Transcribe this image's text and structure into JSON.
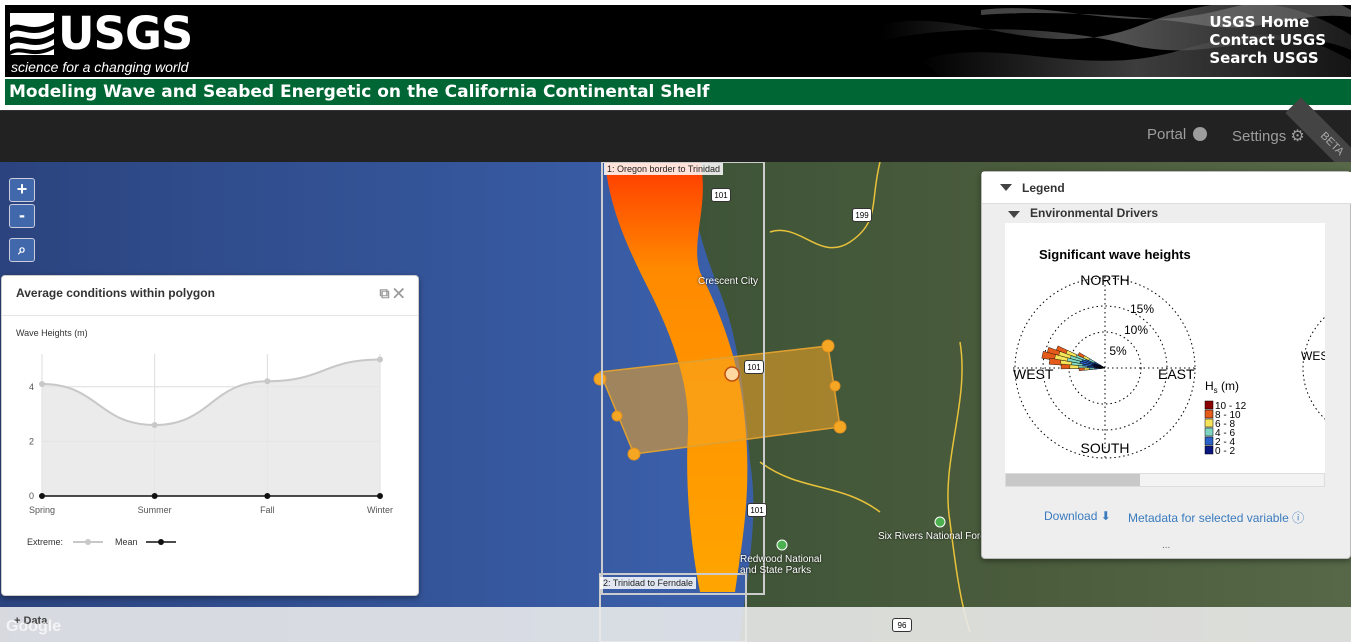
{
  "header": {
    "logo_text": "USGS",
    "logo_tagline": "science for a changing world",
    "links": [
      "USGS Home",
      "Contact USGS",
      "Search USGS"
    ],
    "title": "Modeling Wave and Seabed Energetic on the California Continental Shelf"
  },
  "navbar": {
    "portal_label": "Portal",
    "settings_label": "Settings",
    "beta_label": "BETA"
  },
  "map": {
    "zoom_in": "+",
    "zoom_out": "-",
    "polygon_labels": [
      "1: Oregon border to Trinidad",
      "2: Trinidad to Ferndale"
    ],
    "places": [
      "Crescent City",
      "Redwood National and State Parks",
      "Six Rivers National Forest"
    ],
    "highway_shields": [
      "101",
      "199",
      "101",
      "101",
      "96"
    ],
    "attribution": "Google",
    "data_tab": "Data"
  },
  "avg_panel": {
    "title": "Average conditions within polygon",
    "chart_title": "Wave Heights (m)",
    "legend_extreme": "Extreme:",
    "legend_mean": "Mean"
  },
  "chart_data": {
    "type": "area",
    "title": "Wave Heights (m)",
    "categories": [
      "Spring",
      "Summer",
      "Fall",
      "Winter"
    ],
    "series": [
      {
        "name": "Extreme",
        "values": [
          4.1,
          2.6,
          4.2,
          5.0
        ]
      },
      {
        "name": "Mean",
        "values": [
          0,
          0,
          0,
          0
        ]
      }
    ],
    "y_ticks": [
      0,
      2,
      4
    ],
    "ylim": [
      0,
      5.2
    ],
    "grid": true,
    "legend": "bottom-left"
  },
  "legend_panel": {
    "title": "Legend",
    "section": "Environmental Drivers",
    "rose": {
      "title": "Significant wave heights",
      "north": "NORTH",
      "south": "SOUTH",
      "east": "EAST",
      "west": "WEST",
      "west_partial": "WES",
      "rings": [
        "15%",
        "10%",
        "5%"
      ],
      "hs_label_main": "H",
      "hs_label_sub": "s",
      "hs_label_unit": "(m)",
      "bins": [
        "10 - 12",
        "8 - 10",
        "6 - 8",
        "4 - 6",
        "2 - 4",
        "0 - 2"
      ],
      "bin_colors": [
        "#8b0000",
        "#e35a1a",
        "#f5e35a",
        "#7fd6c0",
        "#2a62c8",
        "#0b1780"
      ]
    },
    "download_label": "Download",
    "metadata_label": "Metadata for selected variable",
    "footer_mark": "..."
  }
}
